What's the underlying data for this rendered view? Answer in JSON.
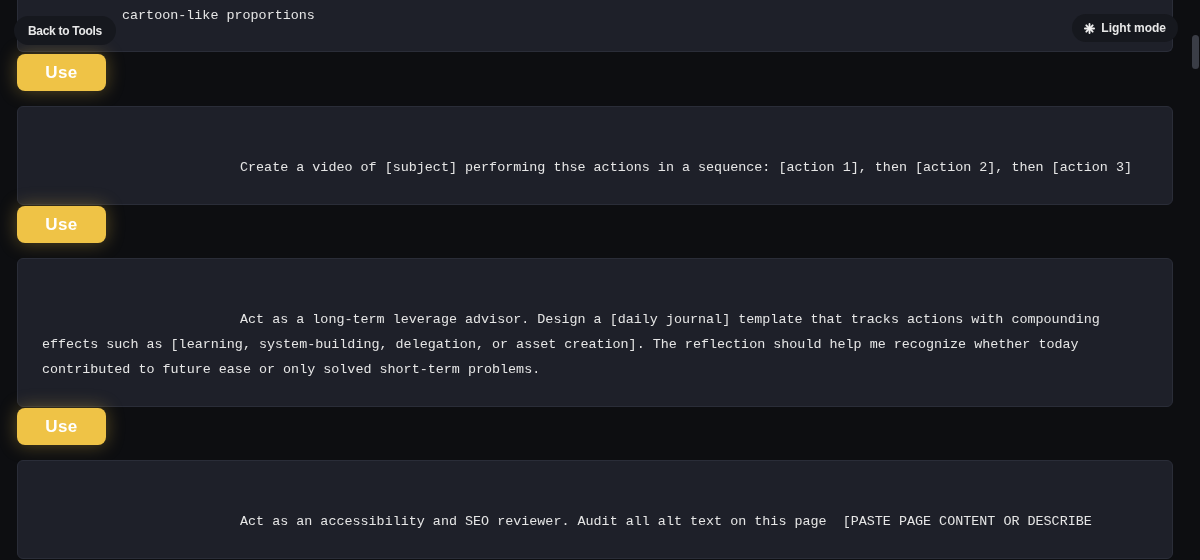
{
  "nav": {
    "back_button": "Back to Tools",
    "theme_toggle": "Light mode"
  },
  "prompts": [
    {
      "text": "cartoon-like proportions",
      "use_button": "Use"
    },
    {
      "text": "Create a video of [subject] performing thse actions in a sequence: [action 1], then [action 2], then [action 3]",
      "use_button": "Use"
    },
    {
      "text": "Act as a long-term leverage advisor. Design a [daily journal] template that tracks actions with compounding effects such as [learning, system-building, delegation, or asset creation]. The reflection should help me recognize whether today contributed to future ease or only solved short-term problems.",
      "use_button": "Use"
    },
    {
      "text": "Act as an accessibility and SEO reviewer. Audit all alt text on this page  [PASTE PAGE CONTENT OR DESCRIBE"
    }
  ]
}
